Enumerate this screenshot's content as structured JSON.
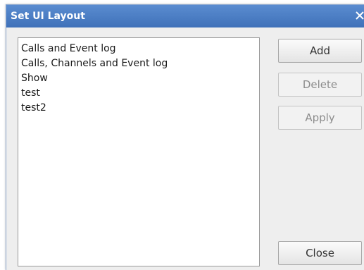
{
  "window": {
    "title": "Set UI Layout",
    "close_icon": "close-icon"
  },
  "layouts": {
    "items": [
      "Calls and Event log",
      "Calls, Channels and Event log",
      "Show",
      "test",
      "test2"
    ]
  },
  "buttons": {
    "add": "Add",
    "delete": "Delete",
    "apply": "Apply",
    "close": "Close"
  },
  "colors": {
    "titlebar": "#4a7dc4",
    "dialog_bg": "#eeeeee",
    "disabled_text": "#8c8c8c"
  }
}
